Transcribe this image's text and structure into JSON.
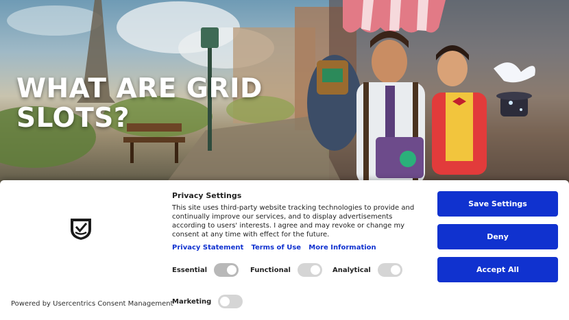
{
  "hero": {
    "title_line1": "WHAT ARE GRID",
    "title_line2": "SLOTS?"
  },
  "consent": {
    "logo_icon": "usercentrics-shield-icon",
    "powered_by": "Powered by Usercentrics Consent Management",
    "title": "Privacy Settings",
    "description": "This site uses third-party website tracking technologies to provide and continually improve our services, and to display advertisements according to users' interests. I agree and may revoke or change my consent at any time with effect for the future.",
    "links": {
      "privacy_statement": "Privacy Statement",
      "terms_of_use": "Terms of Use",
      "more_information": "More Information"
    },
    "toggles": {
      "essential": "Essential",
      "functional": "Functional",
      "analytical": "Analytical",
      "marketing": "Marketing"
    },
    "buttons": {
      "save_settings": "Save Settings",
      "deny": "Deny",
      "accept_all": "Accept All"
    },
    "colors": {
      "accent": "#1032cf",
      "toggle_off": "#d5d5d5"
    }
  }
}
